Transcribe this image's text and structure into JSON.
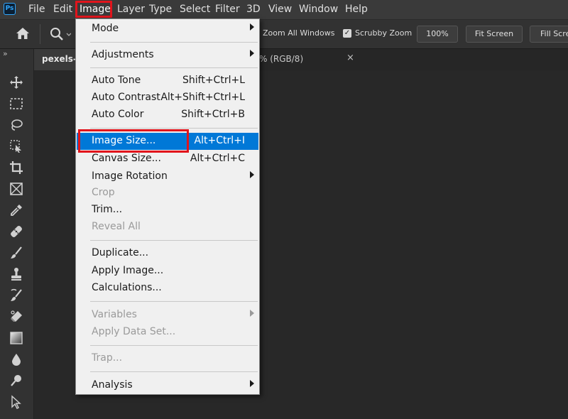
{
  "app": {
    "logo": "Ps"
  },
  "menubar": {
    "items": [
      "File",
      "Edit",
      "Image",
      "Layer",
      "Type",
      "Select",
      "Filter",
      "3D",
      "View",
      "Window",
      "Help"
    ],
    "active": "Image"
  },
  "options": {
    "zoom_all_windows": "Zoom All Windows",
    "scrubby_zoom": "Scrubby Zoom",
    "scrubby_zoom_checked": true,
    "zoom_value": "100%",
    "fit_screen": "Fit Screen",
    "fill_screen": "Fill Scre"
  },
  "tabs": {
    "doc1": "pexels-t",
    "doc2": "% (RGB/8)",
    "close_glyph": "×"
  },
  "toolpanel": {
    "collapse": "»"
  },
  "image_menu": {
    "mode": "Mode",
    "adjustments": "Adjustments",
    "auto_tone": {
      "label": "Auto Tone",
      "shortcut": "Shift+Ctrl+L"
    },
    "auto_contrast": {
      "label": "Auto Contrast",
      "shortcut": "Alt+Shift+Ctrl+L"
    },
    "auto_color": {
      "label": "Auto Color",
      "shortcut": "Shift+Ctrl+B"
    },
    "image_size": {
      "label": "Image Size...",
      "shortcut": "Alt+Ctrl+I"
    },
    "canvas_size": {
      "label": "Canvas Size...",
      "shortcut": "Alt+Ctrl+C"
    },
    "image_rotation": "Image Rotation",
    "crop": "Crop",
    "trim": "Trim...",
    "reveal_all": "Reveal All",
    "duplicate": "Duplicate...",
    "apply_image": "Apply Image...",
    "calculations": "Calculations...",
    "variables": "Variables",
    "apply_data_set": "Apply Data Set...",
    "trap": "Trap...",
    "analysis": "Analysis"
  },
  "colors": {
    "accent_highlight": "#e1141c",
    "selection": "#0078d7",
    "menu_bg": "#f0f0f0",
    "app_bg": "#282828"
  }
}
